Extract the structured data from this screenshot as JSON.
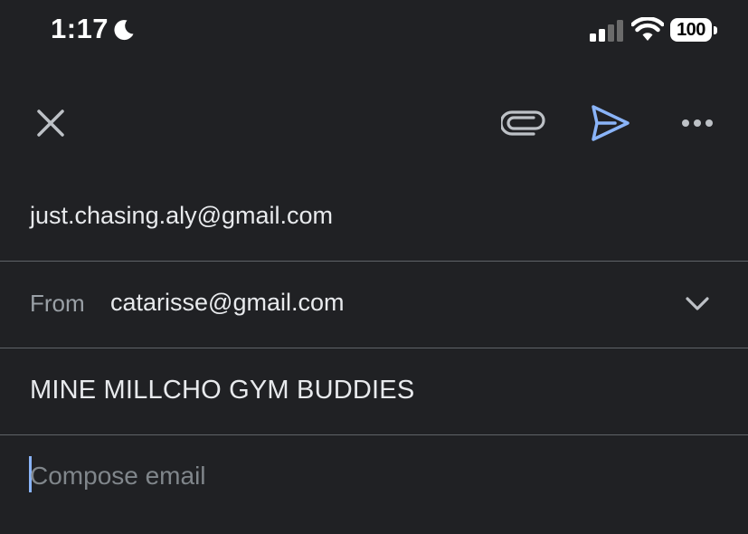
{
  "status_bar": {
    "time": "1:17",
    "battery_level": "100",
    "icons": [
      "moon-icon",
      "signal-icon",
      "wifi-icon",
      "battery-icon"
    ]
  },
  "toolbar": {
    "icons": [
      "close-icon",
      "attach-icon",
      "send-icon",
      "more-icon"
    ]
  },
  "colors": {
    "background": "#202124",
    "text": "#e8eaed",
    "muted": "#9aa0a6",
    "accent": "#8ab4f8",
    "divider": "#5f6368"
  },
  "compose": {
    "to": "just.chasing.aly@gmail.com",
    "from_label": "From",
    "from_value": "catarisse@gmail.com",
    "subject": "MINE MILLCHO GYM BUDDIES",
    "body_placeholder": "Compose email"
  }
}
